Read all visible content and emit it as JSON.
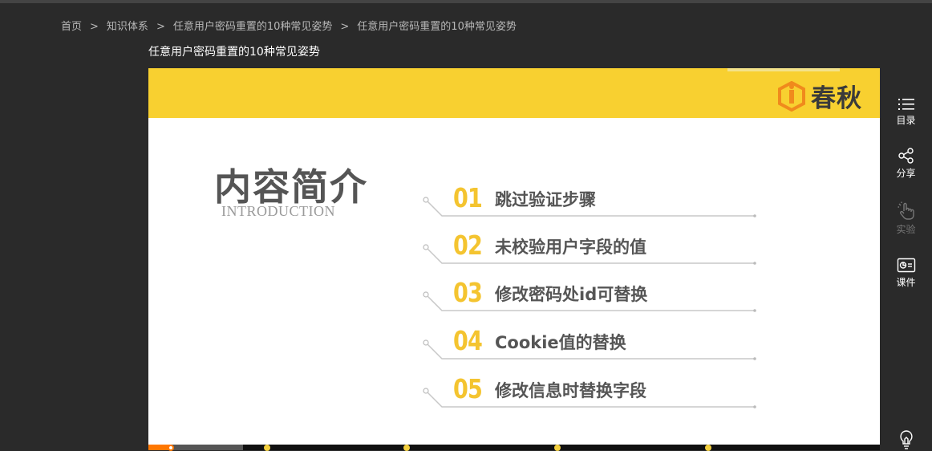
{
  "breadcrumb": [
    {
      "label": "首页"
    },
    {
      "label": "知识体系"
    },
    {
      "label": "任意用户密码重置的10种常见姿势"
    },
    {
      "label": "任意用户密码重置的10种常见姿势"
    }
  ],
  "breadcrumb_sep": ">",
  "page_title": "任意用户密码重置的10种常见姿势",
  "slide": {
    "logo_text": "春秋",
    "heading": "内容简介",
    "heading_en": "INTRODUCTION",
    "items": [
      {
        "num": "01",
        "label": "跳过验证步骤"
      },
      {
        "num": "02",
        "label": "未校验用户字段的值"
      },
      {
        "num": "03",
        "label": "修改密码处id可替换"
      },
      {
        "num": "04",
        "label": "Cookie值的替换"
      },
      {
        "num": "05",
        "label": "修改信息时替换字段"
      }
    ],
    "colors": {
      "header": "#f8d030",
      "number": "#f4c430",
      "text": "#555555"
    }
  },
  "sidebar": [
    {
      "label": "目录",
      "icon": "list-icon",
      "enabled": true
    },
    {
      "label": "分享",
      "icon": "share-icon",
      "enabled": true
    },
    {
      "label": "实验",
      "icon": "hand-pointer-icon",
      "enabled": false
    },
    {
      "label": "课件",
      "icon": "courseware-icon",
      "enabled": true
    }
  ],
  "player": {
    "progress_color": "#ff7700",
    "marker_color": "#f4d03f"
  }
}
